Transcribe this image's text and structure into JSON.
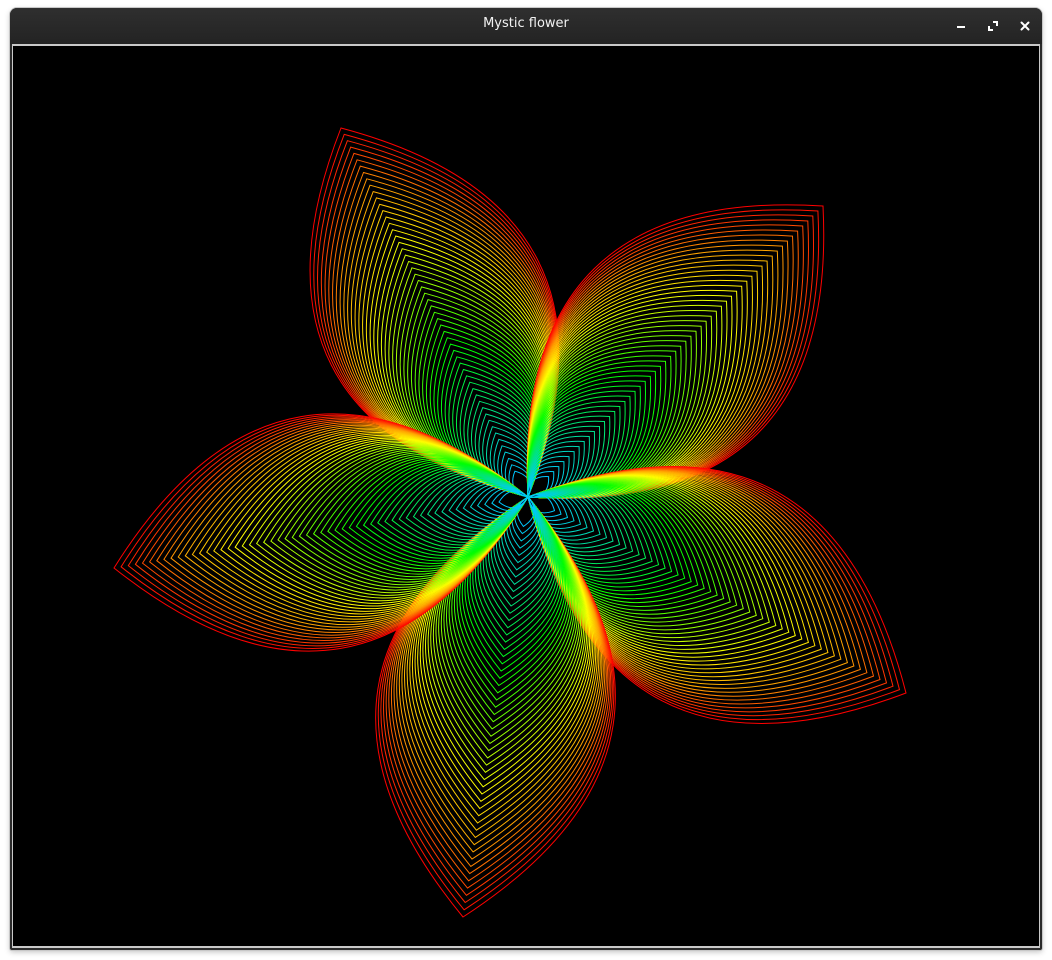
{
  "window": {
    "title": "Mystic flower"
  },
  "controls": {
    "minimize_icon": "minimize-icon",
    "maximize_icon": "maximize-icon",
    "close_icon": "close-icon"
  },
  "canvas": {
    "background": "#000000",
    "petal_count": 5,
    "layers_per_petal": 55,
    "palette": {
      "outer": "#ff0000",
      "mid_outer": "#ffa000",
      "middle": "#ffff00",
      "inner": "#00ff00",
      "core": "#00c8ff"
    }
  }
}
